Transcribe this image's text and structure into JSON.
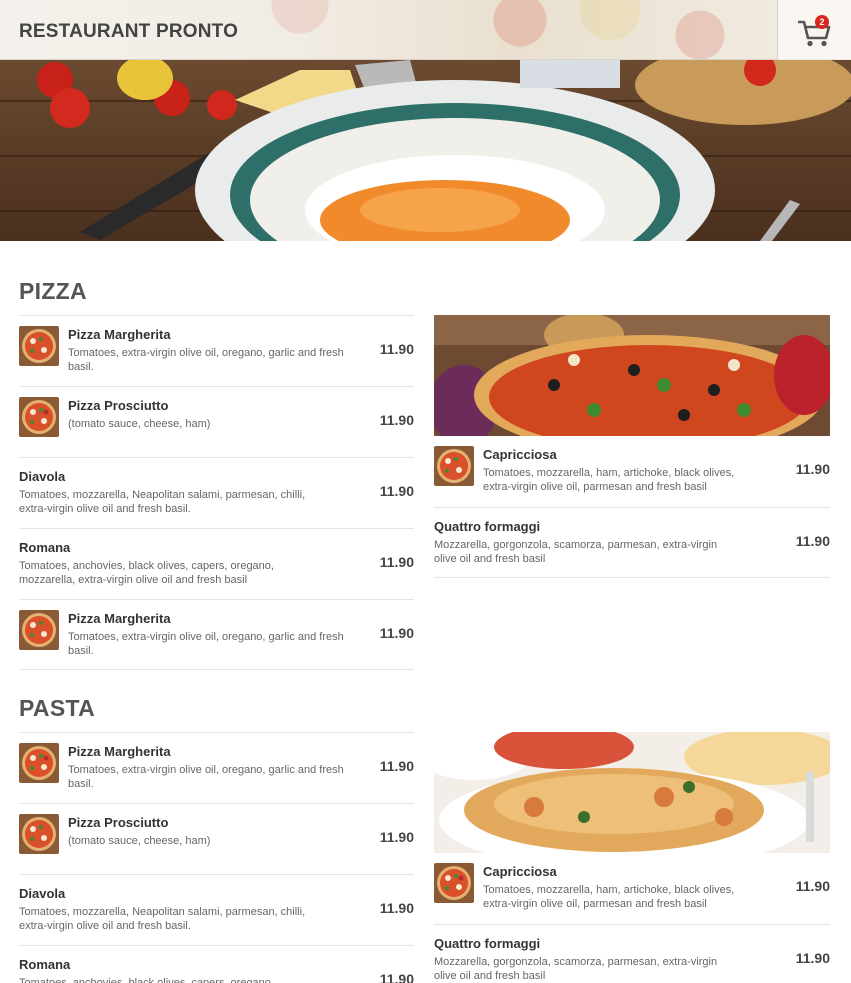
{
  "header": {
    "title": "RESTAURANT PRONTO",
    "cart_count": "2",
    "cart_icon": "cart-icon"
  },
  "sections": [
    {
      "title": "PIZZA",
      "left_items": [
        {
          "name": "Pizza Margherita",
          "desc": "Tomatoes, extra-virgin olive oil, oregano, garlic and fresh basil.",
          "price": "11.90",
          "has_thumb": true
        },
        {
          "name": "Pizza Prosciutto",
          "desc": "(tomato sauce, cheese, ham)",
          "price": "11.90",
          "has_thumb": true
        },
        {
          "name": "Diavola",
          "desc": "Tomatoes, mozzarella, Neapolitan salami, parmesan, chilli, extra-virgin olive oil and fresh basil.",
          "price": "11.90",
          "has_thumb": false
        },
        {
          "name": "Romana",
          "desc": "Tomatoes, anchovies, black olives, capers, oregano, mozzarella, extra-virgin olive oil and fresh basil",
          "price": "11.90",
          "has_thumb": false
        },
        {
          "name": "Pizza Margherita",
          "desc": "Tomatoes, extra-virgin olive oil, oregano, garlic and fresh basil.",
          "price": "11.90",
          "has_thumb": true
        }
      ],
      "right_items": [
        {
          "name": "Capricciosa",
          "desc": "Tomatoes, mozzarella, ham, artichoke, black olives, extra-virgin olive oil, parmesan and fresh basil",
          "price": "11.90",
          "has_thumb": true
        },
        {
          "name": "Quattro formaggi",
          "desc": "Mozzarella, gorgonzola, scamorza, parmesan, extra-virgin olive oil and fresh basil",
          "price": "11.90",
          "has_thumb": false
        }
      ]
    },
    {
      "title": "PASTA",
      "left_items": [
        {
          "name": "Pizza Margherita",
          "desc": "Tomatoes, extra-virgin olive oil, oregano, garlic and fresh basil.",
          "price": "11.90",
          "has_thumb": true
        },
        {
          "name": "Pizza Prosciutto",
          "desc": "(tomato sauce, cheese, ham)",
          "price": "11.90",
          "has_thumb": true
        },
        {
          "name": "Diavola",
          "desc": "Tomatoes, mozzarella, Neapolitan salami, parmesan, chilli, extra-virgin olive oil and fresh basil.",
          "price": "11.90",
          "has_thumb": false
        },
        {
          "name": "Romana",
          "desc": "Tomatoes, anchovies, black olives, capers, oregano,",
          "price": "11.90",
          "has_thumb": false
        }
      ],
      "right_items": [
        {
          "name": "Capricciosa",
          "desc": "Tomatoes, mozzarella, ham, artichoke, black olives, extra-virgin olive oil, parmesan and fresh basil",
          "price": "11.90",
          "has_thumb": true
        },
        {
          "name": "Quattro formaggi",
          "desc": "Mozzarella, gorgonzola, scamorza, parmesan, extra-virgin olive oil and fresh basil",
          "price": "11.90",
          "has_thumb": false
        }
      ]
    }
  ],
  "colors": {
    "badge": "#d8251d",
    "title_text": "#555555",
    "price_text": "#444444"
  }
}
